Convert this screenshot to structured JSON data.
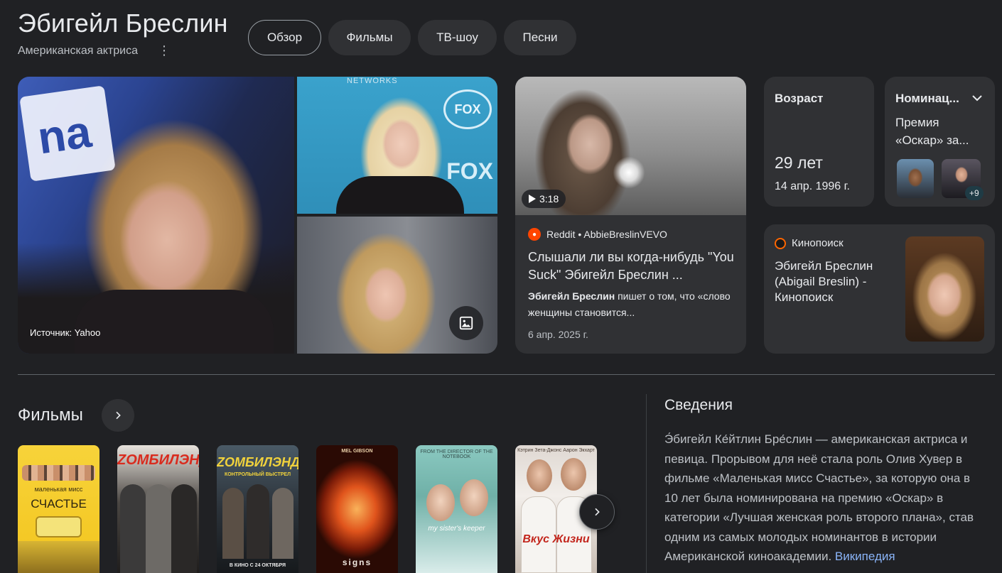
{
  "header": {
    "title": "Эбигейл Бреслин",
    "subtitle": "Американская актриса",
    "tabs": [
      {
        "label": "Обзор",
        "active": true
      },
      {
        "label": "Фильмы",
        "active": false
      },
      {
        "label": "ТВ-шоу",
        "active": false
      },
      {
        "label": "Песни",
        "active": false
      }
    ]
  },
  "images": {
    "source_label": "Источник: Yahoo"
  },
  "video": {
    "duration": "3:18",
    "source": "Reddit • AbbieBreslinVEVO",
    "title": "Слышали ли вы когда-нибудь \"You Suck\" Эбигейл Бреслин ...",
    "snippet_bold": "Эбигейл Бреслин",
    "snippet_rest": " пишет о том, что «слово женщины становится...",
    "date": "6 апр. 2025 г."
  },
  "age": {
    "label": "Возраст",
    "value": "29 лет",
    "birth_date": "14 апр. 1996 г."
  },
  "nominations": {
    "label": "Номинац...",
    "text": "Премия «Оскар» за...",
    "more_count": "+9"
  },
  "kinopoisk": {
    "source": "Кинопоиск",
    "title": "Эбигейл Бреслин (Abigail Breslin) - Кинопоиск"
  },
  "films": {
    "title": "Фильмы",
    "posters": [
      {
        "name": "poster-little-miss-sunshine",
        "line1": "маленькая мисс",
        "line2": "СЧАСТЬЕ"
      },
      {
        "name": "poster-zombieland",
        "line1": "ZOMБИЛЭНД"
      },
      {
        "name": "poster-zombieland-2",
        "line1": "ZOMБИЛЭНД",
        "line2": "КОНТРОЛЬНЫЙ ВЫСТРЕЛ",
        "line3": "В КИНО С 24 ОКТЯБРЯ"
      },
      {
        "name": "poster-signs",
        "line1": "MEL GIBSON",
        "line2": "signs"
      },
      {
        "name": "poster-my-sisters-keeper",
        "line1": "FROM THE DIRECTOR OF THE NOTEBOOK",
        "line2": "my sister's keeper"
      },
      {
        "name": "poster-no-reservations",
        "line1": "Кэтрин Зета-Джонс   Аарон Экхарт",
        "line2": "Вкус Жизни"
      }
    ]
  },
  "about": {
    "title": "Сведения",
    "text": "Э́бигейл Ке́йтлин Бре́слин — американская актриса и певица. Прорывом для неё стала роль Олив Хувер в фильме «Маленькая мисс Счастье», за которую она в 10 лет была номинирована на премию «Оскар» в категории «Лучшая женская роль второго плана», став одним из самых молодых номинантов в истории Американской киноакадемии.",
    "link": "Википедия"
  },
  "colors": {
    "background": "#202124",
    "card": "#303134",
    "link": "#8ab4f8",
    "reddit": "#ff4500",
    "kinopoisk": "#ff6600"
  }
}
